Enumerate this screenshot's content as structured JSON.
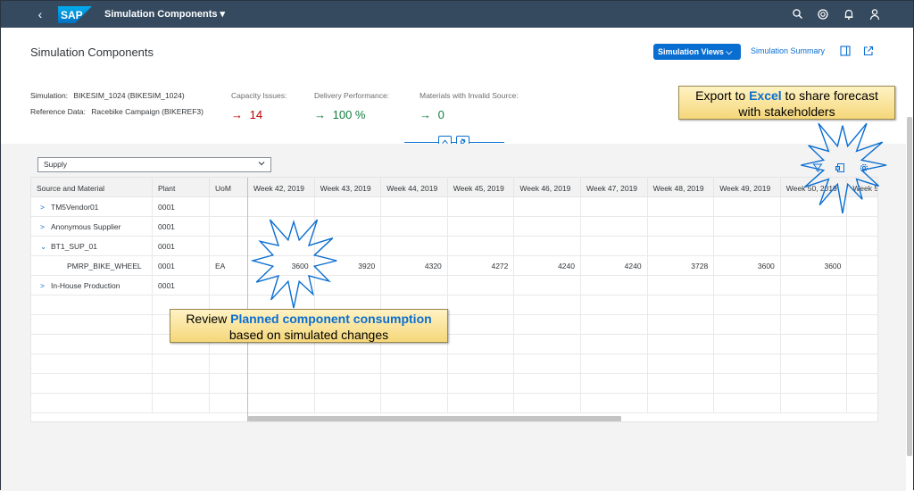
{
  "shell": {
    "back_glyph": "‹",
    "logo_text": "SAP",
    "app_title": "Simulation Components ▾",
    "icons": [
      "search-icon",
      "co-pilot-icon",
      "notifications-bell-icon",
      "user-profile-icon"
    ]
  },
  "header": {
    "title": "Simulation Components",
    "simulation_views_label": "Simulation Views ⌵",
    "simulation_summary_label": "Simulation Summary",
    "attributes": [
      {
        "label": "Simulation:",
        "value": "BIKESIM_1024 (BIKESIM_1024)"
      },
      {
        "label": "Reference Data:",
        "value": "Racebike Campaign (BIKEREF3)"
      }
    ],
    "kpis": [
      {
        "label": "Capacity Issues:",
        "value": "14",
        "arrow": "→",
        "status": "red"
      },
      {
        "label": "Delivery Performance:",
        "value": "100 %",
        "arrow": "→",
        "status": "green"
      },
      {
        "label": "Materials with Invalid Source:",
        "value": "0",
        "arrow": "→",
        "status": "green"
      }
    ]
  },
  "toolbar": {
    "select_value": "Supply",
    "icons": [
      "filter-icon",
      "export-excel-icon",
      "settings-icon"
    ]
  },
  "table": {
    "fixed_columns": [
      "Source and Material",
      "Plant",
      "UoM"
    ],
    "week_columns": [
      "Week 42, 2019",
      "Week 43, 2019",
      "Week 44, 2019",
      "Week 45, 2019",
      "Week 46, 2019",
      "Week 47, 2019",
      "Week 48, 2019",
      "Week 49, 2019",
      "Week 50, 2019",
      "Week 5"
    ],
    "rows": [
      {
        "expander": ">",
        "source": "TM5Vendor01",
        "plant": "0001",
        "uom": "",
        "values": []
      },
      {
        "expander": ">",
        "source": "Anonymous Supplier",
        "plant": "0001",
        "uom": "",
        "values": []
      },
      {
        "expander": "⌄",
        "source": "BT1_SUP_01",
        "plant": "0001",
        "uom": "",
        "values": []
      },
      {
        "expander": "",
        "source": "PMRP_BIKE_WHEEL",
        "plant": "0001",
        "uom": "EA",
        "values": [
          "3600",
          "3920",
          "4320",
          "4272",
          "4240",
          "4240",
          "3728",
          "3600",
          "3600",
          ""
        ]
      },
      {
        "expander": ">",
        "source": "In-House Production",
        "plant": "0001",
        "uom": "",
        "values": []
      }
    ]
  },
  "callouts": {
    "excel": {
      "pre": "Export to ",
      "highlight": "Excel",
      "post": " to share forecast",
      "line2": "with stakeholders"
    },
    "review": {
      "pre": "Review ",
      "highlight": "Planned component consumption",
      "line2": "based on simulated changes"
    }
  },
  "colors": {
    "shell": "#354a5f",
    "accent": "#0a6ed1",
    "negative": "#bb0000",
    "positive": "#107e3e",
    "callout_fill": "#f5d77a"
  }
}
